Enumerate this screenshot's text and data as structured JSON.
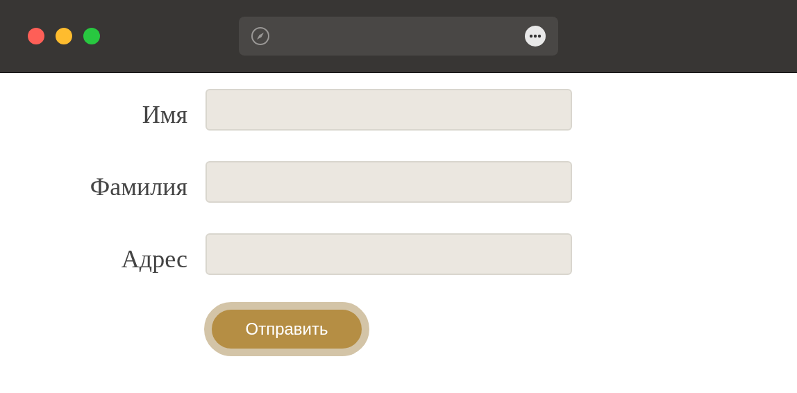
{
  "fields": [
    {
      "label": "Имя"
    },
    {
      "label": "Фамилия"
    },
    {
      "label": "Адрес"
    }
  ],
  "submit": {
    "label": "Отправить"
  }
}
